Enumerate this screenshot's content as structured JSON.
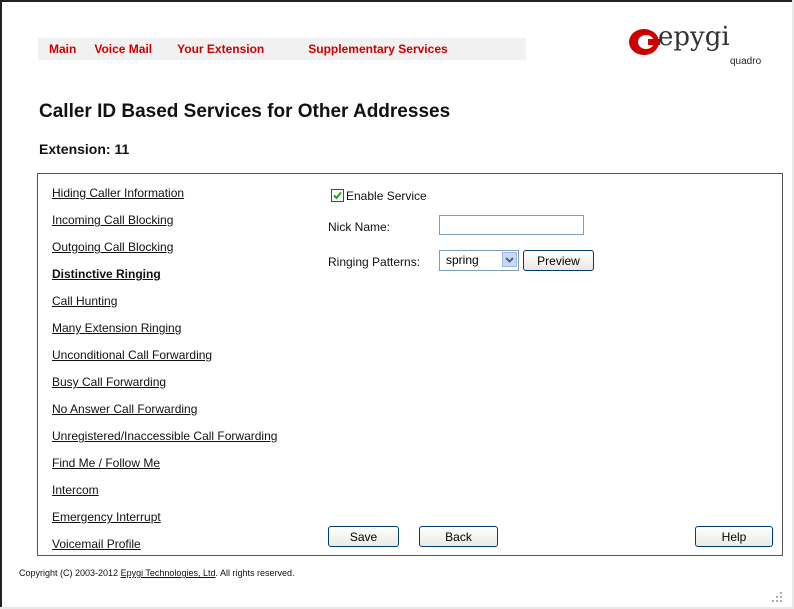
{
  "nav": {
    "items": [
      {
        "label": "Main"
      },
      {
        "label": "Voice Mail"
      },
      {
        "label": "Your Extension"
      },
      {
        "label": "Supplementary Services"
      }
    ]
  },
  "logo": {
    "brand": "epygi",
    "sub": "quadro"
  },
  "page": {
    "title": "Caller ID Based Services for Other Addresses",
    "extension": "Extension: 11"
  },
  "sidebar": {
    "items": [
      {
        "label": "Hiding Caller Information",
        "active": false
      },
      {
        "label": "Incoming Call Blocking",
        "active": false
      },
      {
        "label": "Outgoing Call Blocking",
        "active": false
      },
      {
        "label": "Distinctive Ringing",
        "active": true
      },
      {
        "label": "Call Hunting",
        "active": false
      },
      {
        "label": "Many Extension Ringing",
        "active": false
      },
      {
        "label": "Unconditional Call Forwarding",
        "active": false
      },
      {
        "label": "Busy Call Forwarding",
        "active": false
      },
      {
        "label": "No Answer Call Forwarding",
        "active": false
      },
      {
        "label": "Unregistered/Inaccessible Call Forwarding",
        "active": false
      },
      {
        "label": "Find Me / Follow Me",
        "active": false
      },
      {
        "label": "Intercom",
        "active": false
      },
      {
        "label": "Emergency Interrupt",
        "active": false
      },
      {
        "label": "Voicemail Profile",
        "active": false
      }
    ]
  },
  "form": {
    "enable_service": {
      "label": "Enable Service",
      "checked": true
    },
    "nick_name": {
      "label": "Nick Name:",
      "value": ""
    },
    "ringing_patterns": {
      "label": "Ringing Patterns:",
      "selected": "spring"
    },
    "preview_label": "Preview"
  },
  "buttons": {
    "save": "Save",
    "back": "Back",
    "help": "Help"
  },
  "footer": {
    "copyright_prefix": "Copyright (C) 2003-2012 ",
    "company_link": "Epygi Technologies, Ltd",
    "copyright_suffix": ". All rights reserved."
  },
  "colors": {
    "nav_link": "#cc0000",
    "brand_red": "#cc0000",
    "nav_bg": "#f1f1f1"
  }
}
